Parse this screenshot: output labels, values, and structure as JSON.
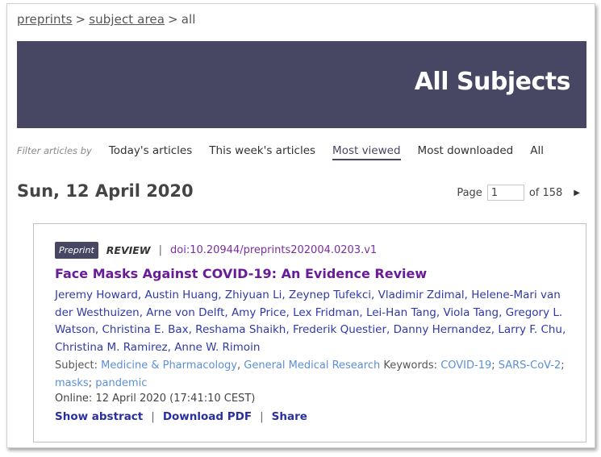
{
  "breadcrumb": {
    "items": [
      "preprints",
      "subject area",
      "all"
    ],
    "separator": ">"
  },
  "banner": {
    "title": "All Subjects",
    "color": "#474764"
  },
  "filters": {
    "label": "Filter articles by",
    "options": [
      "Today's articles",
      "This week's articles",
      "Most viewed",
      "Most downloaded",
      "All"
    ],
    "active": "Most viewed"
  },
  "date_heading": "Sun, 12 April 2020",
  "pager": {
    "label": "Page",
    "value": "1",
    "of_label": "of 158",
    "next_icon": "triangle-right"
  },
  "article": {
    "badge": "Preprint",
    "type": "REVIEW",
    "separator": "|",
    "doi": "doi:10.20944/preprints202004.0203.v1",
    "title": "Face Masks Against COVID-19: An Evidence Review",
    "authors": "Jeremy Howard, Austin Huang, Zhiyuan Li, Zeynep Tufekci, Vladimir Zdimal, Helene-Mari van der Westhuizen, Arne von Delft, Amy Price, Lex Fridman, Lei-Han Tang, Viola Tang, Gregory L. Watson, Christina E. Bax, Reshama Shaikh, Frederik Questier, Danny Hernandez, Larry F. Chu, Christina M. Ramirez, Anne W. Rimoin",
    "subject_label": "Subject:",
    "subjects": [
      "Medicine & Pharmacology",
      "General Medical Research"
    ],
    "keywords_label": "Keywords:",
    "keywords": [
      "COVID-19",
      "SARS-CoV-2",
      "masks",
      "pandemic"
    ],
    "online": "Online: 12 April 2020 (17:41:10 CEST)",
    "actions": [
      "Show abstract",
      "Download PDF",
      "Share"
    ]
  }
}
